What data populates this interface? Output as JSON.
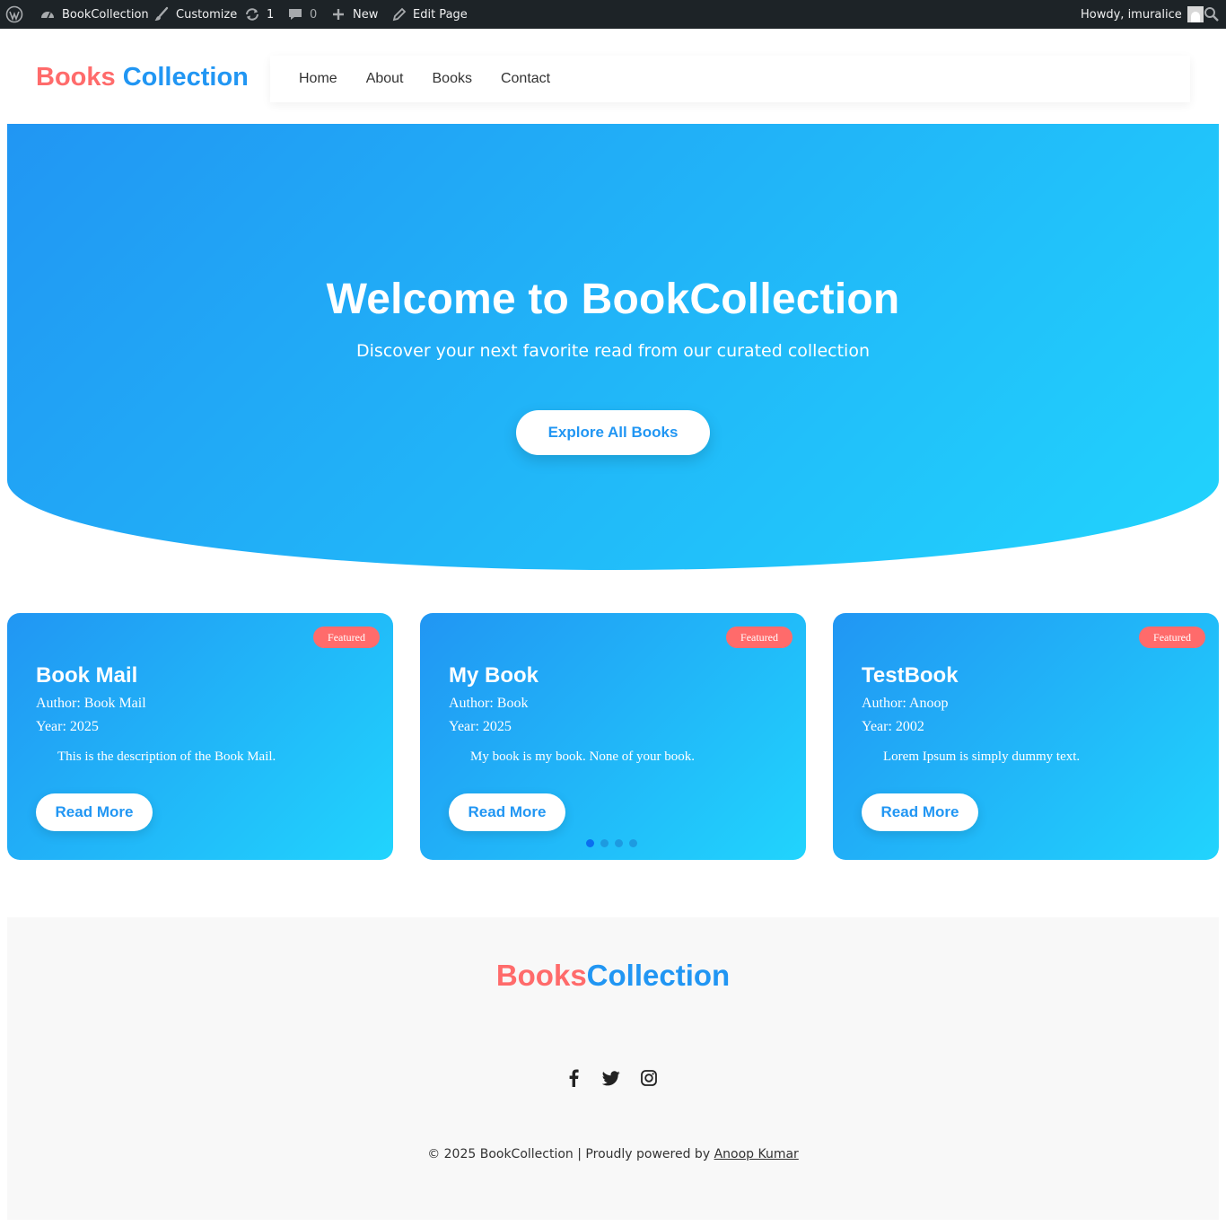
{
  "admin_bar": {
    "site_name": "BookCollection",
    "customize": "Customize",
    "updates_count": "1",
    "comments_count": "0",
    "new_label": "New",
    "edit_page": "Edit Page",
    "howdy": "Howdy, imuralice"
  },
  "header": {
    "logo_part1": "Books",
    "logo_part2": "Collection",
    "nav": [
      "Home",
      "About",
      "Books",
      "Contact"
    ]
  },
  "hero": {
    "title": "Welcome to BookCollection",
    "subtitle": "Discover your next favorite read from our curated collection",
    "cta": "Explore All Books"
  },
  "cards": [
    {
      "badge": "Featured",
      "title": "Book Mail",
      "author": "Author: Book Mail",
      "year": "Year: 2025",
      "description": "This is the description of the Book Mail.",
      "button": "Read More"
    },
    {
      "badge": "Featured",
      "title": "My Book",
      "author": "Author: Book",
      "year": "Year: 2025",
      "description": "My book is my book. None of your book.",
      "button": "Read More"
    },
    {
      "badge": "Featured",
      "title": "TestBook",
      "author": "Author: Anoop",
      "year": "Year: 2002",
      "description": "Lorem Ipsum is simply dummy text.",
      "button": "Read More"
    }
  ],
  "carousel": {
    "total": 4,
    "active_index": 0
  },
  "footer": {
    "logo_part1": "Books",
    "logo_part2": "Collection",
    "social": [
      "facebook-icon",
      "twitter-icon",
      "instagram-icon"
    ],
    "copyright_text": "© 2025 BookCollection | Proudly powered by ",
    "author_link": "Anoop Kumar"
  },
  "colors": {
    "brand_red": "#ff6b6b",
    "brand_blue": "#2196f3",
    "gradient_end": "#21d4fd",
    "admin_bar": "#1d2327"
  }
}
